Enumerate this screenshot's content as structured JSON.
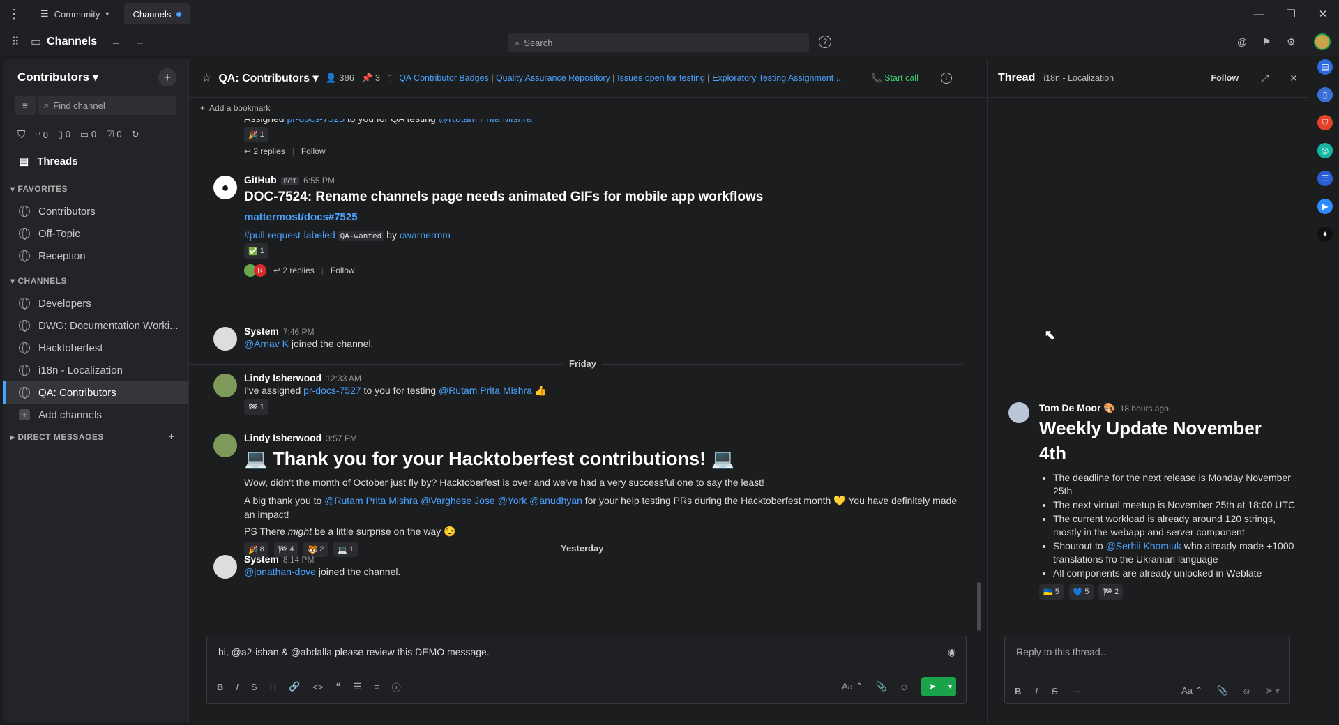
{
  "titlebar": {
    "menu_icon": "dots-vertical-icon",
    "workspace_tab": "Community",
    "channels_tab": "Channels",
    "min": "—",
    "max": "❐",
    "close": "✕"
  },
  "header": {
    "app_title": "Channels",
    "search_placeholder": "Search"
  },
  "sidebar": {
    "team": "Contributors",
    "find_placeholder": "Find channel",
    "git_counts": [
      "0",
      "0",
      "0",
      "0"
    ],
    "threads": "Threads",
    "favorites_label": "FAVORITES",
    "favorites": [
      "Contributors",
      "Off-Topic",
      "Reception"
    ],
    "channels_label": "CHANNELS",
    "channels": [
      "Developers",
      "DWG: Documentation Worki...",
      "Hacktoberfest",
      "i18n - Localization",
      "QA: Contributors"
    ],
    "add_channels": "Add channels",
    "dm_label": "DIRECT MESSAGES"
  },
  "channel": {
    "title": "QA: Contributors",
    "members": "386",
    "pinned": "3",
    "bookmarks": [
      "QA Contributor Badges",
      "Quality Assurance Repository",
      "Issues open for testing",
      "Exploratory Testing Assignment ..."
    ],
    "start_call": "Start call",
    "add_bookmark": "Add a bookmark"
  },
  "posts": {
    "p0": {
      "text_a": "Assigned ",
      "link": "pr-docs-7525",
      "text_b": " to you for QA testing ",
      "mention": "@Rutam Prita Mishra",
      "reaction": "1",
      "replies": "2 replies",
      "follow": "Follow"
    },
    "p1": {
      "name": "GitHub",
      "badge": "BOT",
      "time": "6:55 PM",
      "title": "DOC-7524: Rename channels page needs animated GIFs for mobile app workflows",
      "repo_link": "mattermost/docs#7525",
      "tag": "#pull-request-labeled",
      "code": "QA-wanted",
      "by": "by",
      "author": "cwarnermm",
      "reaction": "1",
      "replies": "2 replies",
      "follow": "Follow",
      "avatar_r": "R"
    },
    "p2": {
      "name": "System",
      "time": "7:46 PM",
      "mention": "@Arnav K",
      "text": " joined the channel."
    },
    "div_friday": "Friday",
    "p3": {
      "name": "Lindy Isherwood",
      "time": "12:33 AM",
      "text_a": "I've assigned ",
      "link": "pr-docs-7527",
      "text_b": " to you for testing ",
      "mention": "@Rutam Prita Mishra",
      "emoji": "👍",
      "reaction": "1"
    },
    "p4": {
      "name": "Lindy Isherwood",
      "time": "3:57 PM",
      "heading": "Thank you for your Hacktoberfest contributions!",
      "line1": "Wow, didn't the month of October just fly by? Hacktoberfest is over and we've had a very successful one to say the least!",
      "line2_a": "A big thank you to ",
      "mentions": "@Rutam Prita Mishra @Varghese Jose @York @anudhyan",
      "line2_b": " for your help testing PRs during the Hacktoberfest month 💛 You have definitely made an impact!",
      "ps_a": "PS There ",
      "ps_em": "might",
      "ps_b": " be a little surprise on the way 😉",
      "reactions": [
        "8",
        "4",
        "2",
        "1"
      ]
    },
    "div_yesterday": "Yesterday",
    "p5": {
      "name": "System",
      "time": "8:14 PM",
      "mention": "@jonathan-dove",
      "text": " joined the channel."
    }
  },
  "composer": {
    "text": "hi, @a2-ishan & @abdalla please review this DEMO message.",
    "aa": "Aa"
  },
  "thread": {
    "title": "Thread",
    "channel": "i18n - Localization",
    "follow": "Follow",
    "author": "Tom De Moor",
    "time": "18 hours ago",
    "heading": "Weekly Update November 4th",
    "b1": "The deadline for the next release is Monday November 25th",
    "b2": "The next virtual meetup is November 25th at 18:00 UTC",
    "b3": "The current workload is already around 120 strings, mostly in the webapp and server component",
    "b4_a": "Shoutout to ",
    "b4_m": "@Serhii Khomiuk",
    "b4_b": " who already made +1000 translations fro the Ukranian language",
    "b5": "All components are already unlocked in Weblate",
    "reactions": [
      "5",
      "5",
      "2"
    ],
    "reply_placeholder": "Reply to this thread...",
    "aa": "Aa"
  },
  "colors": {
    "accent": "#4aa3ff",
    "online": "#1aa34a"
  }
}
